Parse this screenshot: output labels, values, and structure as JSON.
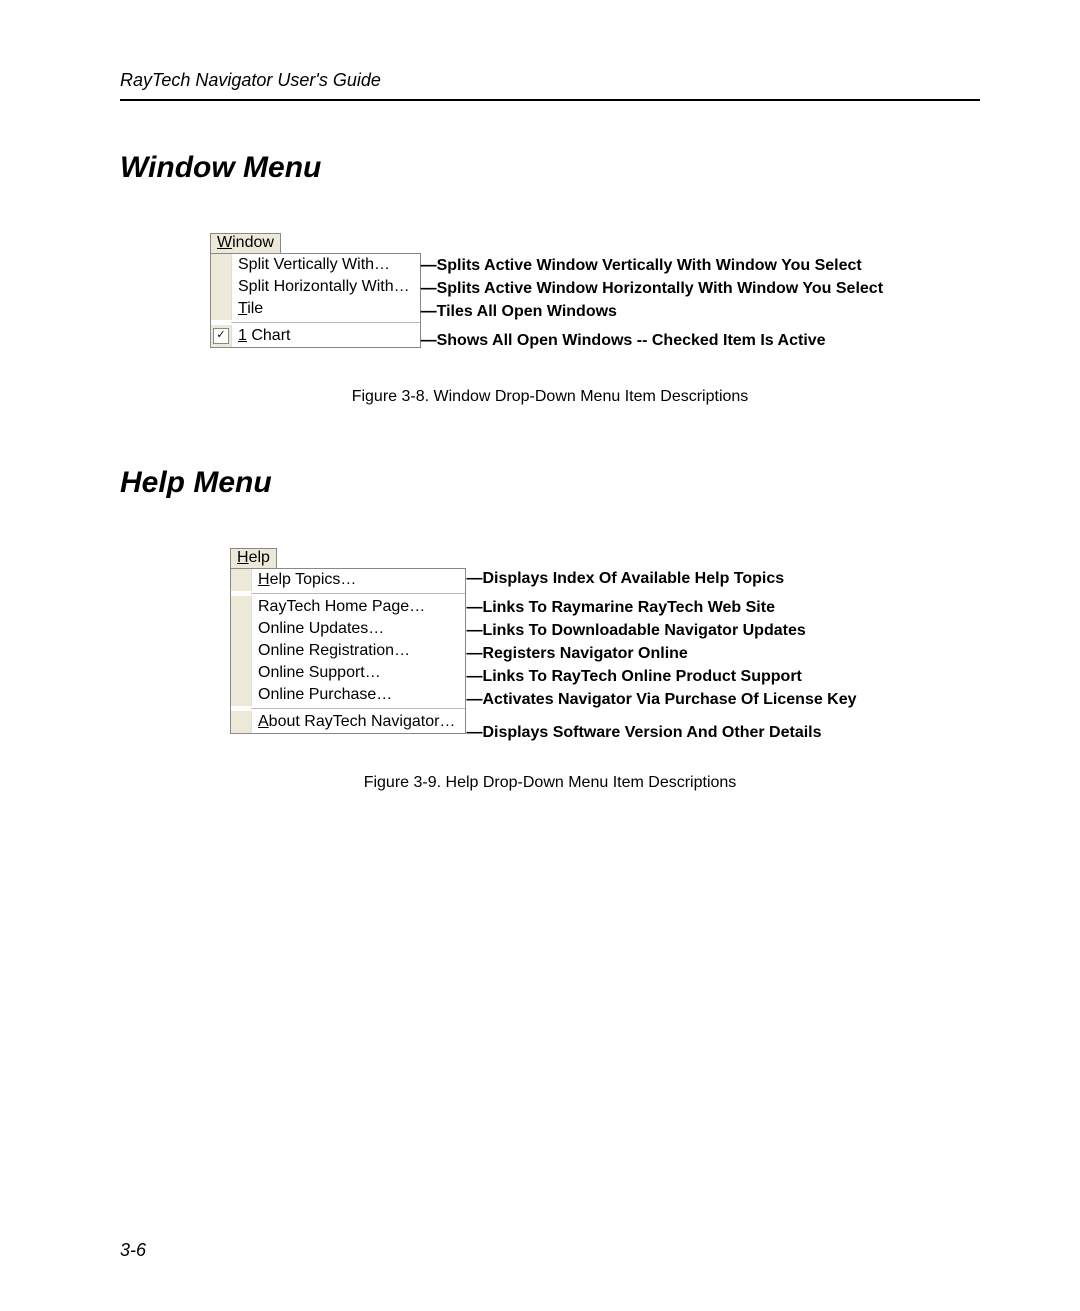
{
  "header": {
    "running": "RayTech Navigator User's Guide"
  },
  "page_number": "3-6",
  "window_section": {
    "heading": "Window Menu",
    "menu_title": "Window",
    "items": [
      {
        "label": "Split Vertically With…",
        "desc": "—Splits Active Window Vertically With Window You Select"
      },
      {
        "label": "Split Horizontally With…",
        "desc": "—Splits Active Window Horizontally With Window You Select"
      },
      {
        "label": "Tile",
        "desc": "—Tiles All Open Windows",
        "accel": "T"
      }
    ],
    "checked_item": {
      "label": "1 Chart",
      "desc": "—Shows All Open Windows -- Checked Item Is Active",
      "accel": "1"
    },
    "caption": "Figure 3-8.  Window Drop-Down Menu Item Descriptions"
  },
  "help_section": {
    "heading": "Help Menu",
    "menu_title": "Help",
    "group1": [
      {
        "label": "Help Topics…",
        "desc": "—Displays Index Of Available Help Topics",
        "accel": "H"
      }
    ],
    "group2": [
      {
        "label": "RayTech Home Page…",
        "desc": "—Links To Raymarine RayTech Web Site"
      },
      {
        "label": "Online Updates…",
        "desc": "—Links To Downloadable Navigator Updates"
      },
      {
        "label": "Online Registration…",
        "desc": "—Registers Navigator Online"
      },
      {
        "label": "Online Support…",
        "desc": "—Links To RayTech Online Product Support"
      },
      {
        "label": "Online Purchase…",
        "desc": "—Activates Navigator Via Purchase Of License Key"
      }
    ],
    "group3": [
      {
        "label": "About RayTech Navigator…",
        "desc": "—Displays Software Version And Other Details",
        "accel": "A"
      }
    ],
    "caption": "Figure 3-9.  Help Drop-Down Menu Item Descriptions"
  }
}
